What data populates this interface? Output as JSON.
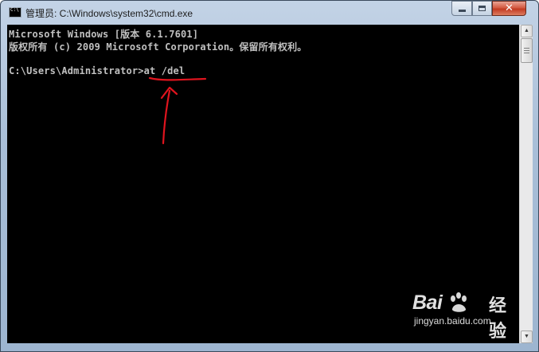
{
  "window": {
    "title": "管理员: C:\\Windows\\system32\\cmd.exe",
    "icon": "cmd-console-icon",
    "controls": {
      "minimize_icon": "minimize-icon",
      "maximize_icon": "maximize-icon",
      "close_icon": "close-icon",
      "close_glyph": "✕"
    }
  },
  "console": {
    "lines": [
      "Microsoft Windows [版本 6.1.7601]",
      "版权所有 (c) 2009 Microsoft Corporation。保留所有权利。",
      "C:\\Users\\Administrator>at /del"
    ],
    "text_color": "#c0c0c0",
    "background": "#000000"
  },
  "annotation": {
    "color": "#e0141e",
    "shape": "underline-with-arrow"
  },
  "scrollbar": {
    "up_glyph": "▲",
    "down_glyph": "▼"
  },
  "watermark": {
    "brand_left": "Bai",
    "brand_right": "经验",
    "url": "jingyan.baidu.com"
  }
}
